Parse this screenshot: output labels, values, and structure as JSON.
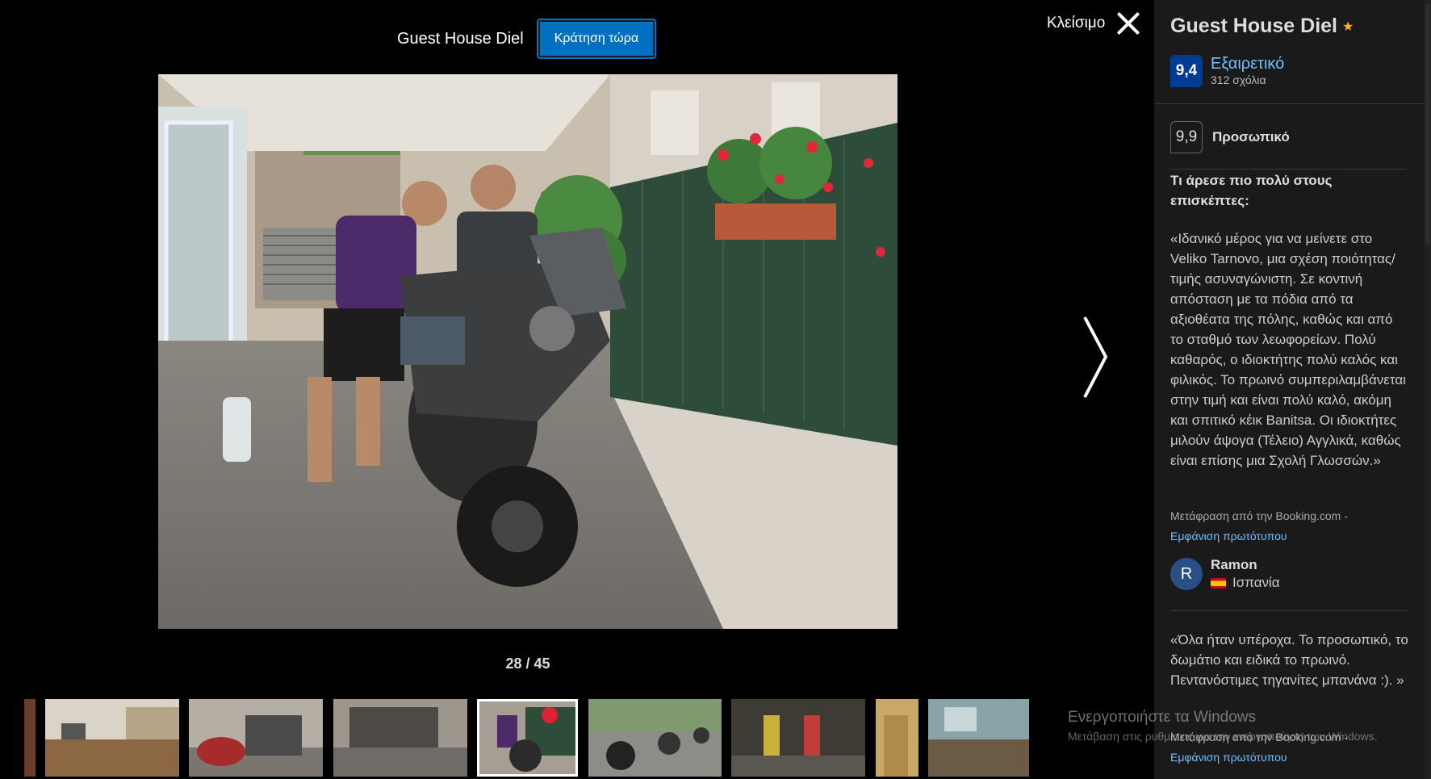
{
  "gallery": {
    "title": "Guest House Diel",
    "book_button": "Κράτηση τώρα",
    "close_label": "Κλείσιμο",
    "counter": "28 / 45"
  },
  "sidebar": {
    "hotel_name": "Guest House Diel",
    "stars": "★",
    "score": "9,4",
    "score_word": "Εξαιρετικό",
    "review_count": "312 σχόλια",
    "category": {
      "score": "9,9",
      "label": "Προσωπικό"
    },
    "liked_heading": "Τι άρεσε πιο πολύ στους επισκέπτες:",
    "review1": {
      "text": "«Ιδανικό μέρος για να μείνετε στο Veliko Tarnovo, μια σχέση ποιότητας/τιμής ασυναγώνιστη. Σε κοντινή απόσταση με τα πόδια από τα αξιοθέατα της πόλης, καθώς και από το σταθμό των λεωφορείων. Πολύ καθαρός, ο ιδιοκτήτης πολύ καλός και φιλικός. Το πρωινό συμπεριλαμβάνεται στην τιμή και είναι πολύ καλό, ακόμη και σπιτικό κέικ Banitsa. Οι ιδιοκτήτες μιλούν άψογα (Τέλειο) Αγγλικά, καθώς είναι επίσης μια Σχολή Γλωσσών.»",
      "translated_by": "Μετάφραση από την Booking.com -",
      "show_original": "Εμφάνιση πρωτότυπου",
      "reviewer_initial": "R",
      "reviewer_name": "Ramon",
      "reviewer_country": "Ισπανία"
    },
    "review2": {
      "text": "«Όλα ήταν υπέροχα. Το προσωπικό, το δωμάτιο και ειδικά το πρωινό. Πεντανόστιμες τηγανίτες μπανάνα :). »",
      "translated_by": "Μετάφραση από την Booking.com -",
      "show_original": "Εμφάνιση πρωτότυπου"
    }
  },
  "watermark": {
    "line1": "Ενεργοποιήστε τα Windows",
    "line2": "Μετάβαση στις ρυθμίσεις για την ενεργοποίηση των Windows."
  },
  "colors": {
    "accent_blue": "#0071c2",
    "score_badge": "#003b95",
    "link_blue": "#71c0ff",
    "star_yellow": "#febb02"
  }
}
